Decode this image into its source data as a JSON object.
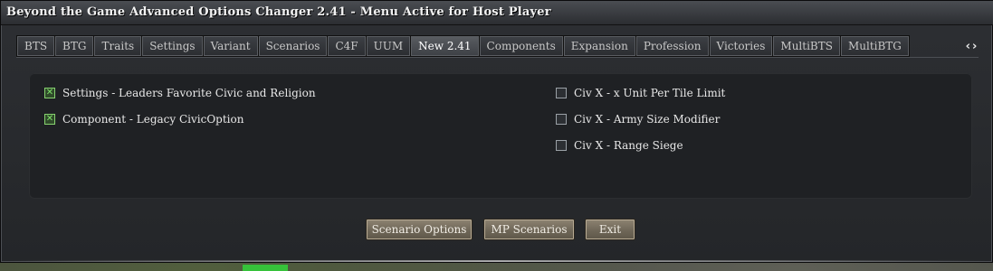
{
  "window": {
    "title": "Beyond the Game Advanced Options Changer 2.41 - Menu Active for Host Player"
  },
  "tabs": [
    {
      "label": "BTS"
    },
    {
      "label": "BTG"
    },
    {
      "label": "Traits"
    },
    {
      "label": "Settings"
    },
    {
      "label": "Variant"
    },
    {
      "label": "Scenarios"
    },
    {
      "label": "C4F"
    },
    {
      "label": "UUM"
    },
    {
      "label": "New 2.41",
      "active": true
    },
    {
      "label": "Components"
    },
    {
      "label": "Expansion"
    },
    {
      "label": "Profession"
    },
    {
      "label": "Victories"
    },
    {
      "label": "MultiBTS"
    },
    {
      "label": "MultiBTG"
    }
  ],
  "tab_scroll": "‹›",
  "options_left": [
    {
      "label": "Settings - Leaders Favorite Civic and Religion",
      "checked": true
    },
    {
      "label": "Component - Legacy CivicOption",
      "checked": true
    }
  ],
  "options_right": [
    {
      "label": "Civ X - x Unit Per Tile Limit",
      "checked": false
    },
    {
      "label": "Civ X - Army Size Modifier",
      "checked": false
    },
    {
      "label": "Civ X - Range Siege",
      "checked": false
    }
  ],
  "buttons": {
    "scenario_options": "Scenario Options",
    "mp_scenarios": "MP Scenarios",
    "exit": "Exit"
  }
}
